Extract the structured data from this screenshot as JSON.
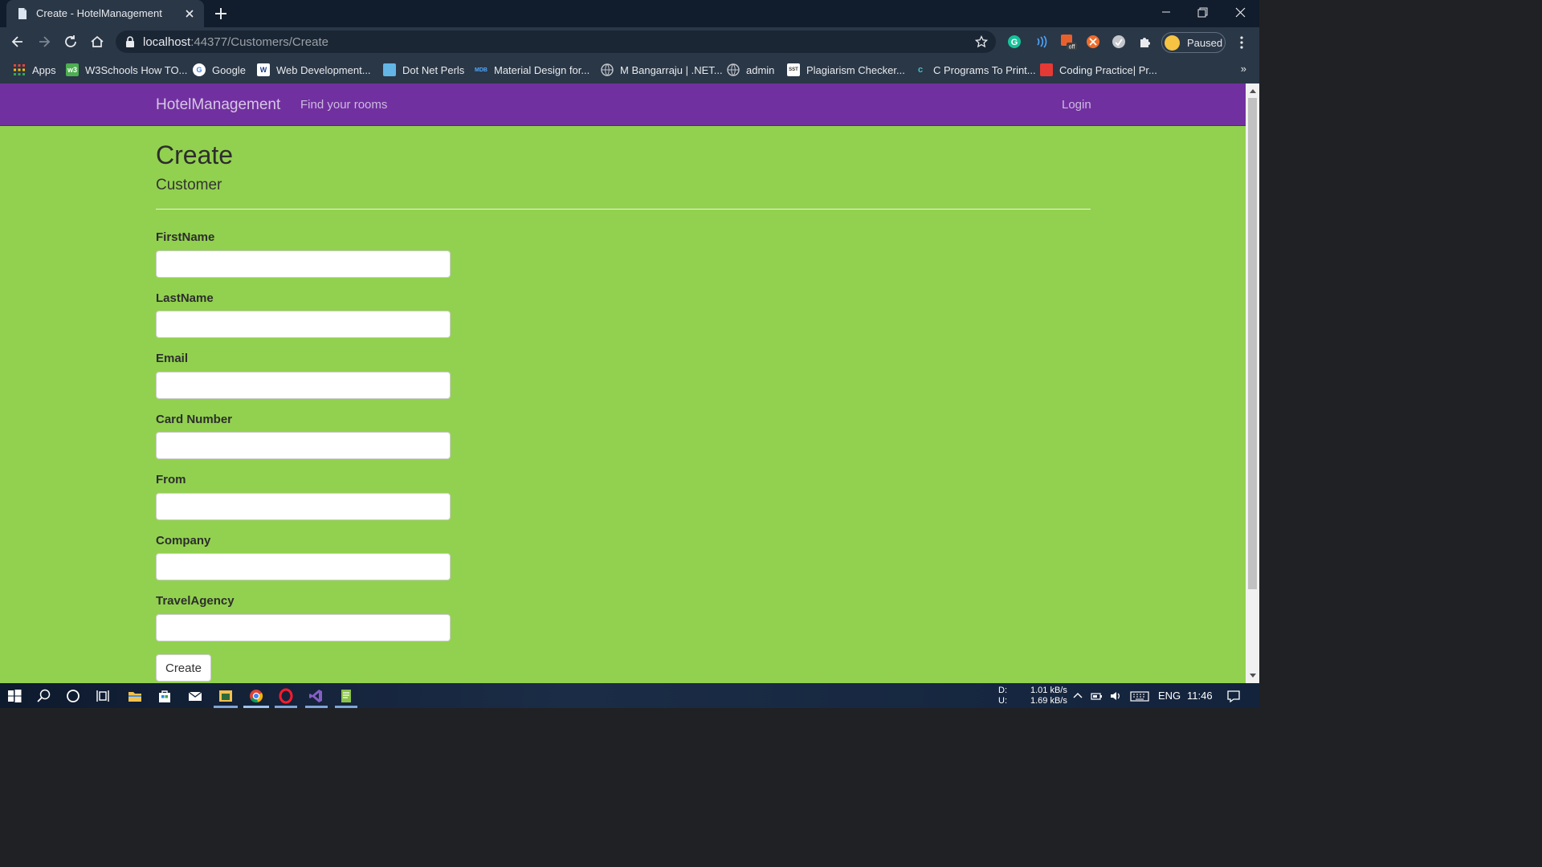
{
  "browser": {
    "tab_title": "Create - HotelManagement",
    "url_host": "localhost",
    "url_path": ":44377/Customers/Create",
    "profile_label": "Paused",
    "bookmarks": [
      {
        "label": "Apps",
        "icon": "apps-grid-icon",
        "color": "#e8453c"
      },
      {
        "label": "W3Schools How TO...",
        "icon": "w3schools-icon",
        "color": "#4caf50"
      },
      {
        "label": "Google",
        "icon": "google-icon",
        "color": "#ffffff"
      },
      {
        "label": "Web Development...",
        "icon": "web-dev-icon",
        "color": "#ffffff"
      },
      {
        "label": "Dot Net Perls",
        "icon": "dotnetperls-icon",
        "color": "#62b5e5"
      },
      {
        "label": "Material Design for...",
        "icon": "mdb-icon",
        "color": "#1976d2"
      },
      {
        "label": "M Bangarraju | .NET...",
        "icon": "globe-icon",
        "color": "#9aa0a6"
      },
      {
        "label": "admin",
        "icon": "globe-icon",
        "color": "#9aa0a6"
      },
      {
        "label": "Plagiarism Checker...",
        "icon": "sst-icon",
        "color": "#ffffff"
      },
      {
        "label": "C Programs To Print...",
        "icon": "c-programs-icon",
        "color": "#1b8a8a"
      },
      {
        "label": "Coding Practice| Pr...",
        "icon": "coding-practice-icon",
        "color": "#e53935"
      }
    ],
    "bookmarks_overflow": "»"
  },
  "site": {
    "brand": "HotelManagement",
    "nav_find_rooms": "Find your rooms",
    "nav_login": "Login",
    "navbar_color": "#7130a0",
    "page_bg_color": "#92d14f"
  },
  "page": {
    "title": "Create",
    "subtitle": "Customer",
    "fields": [
      {
        "label": "FirstName",
        "value": ""
      },
      {
        "label": "LastName",
        "value": ""
      },
      {
        "label": "Email",
        "value": ""
      },
      {
        "label": "Card Number",
        "value": ""
      },
      {
        "label": "From",
        "value": ""
      },
      {
        "label": "Company",
        "value": ""
      },
      {
        "label": "TravelAgency",
        "value": ""
      }
    ],
    "submit_label": "Create"
  },
  "taskbar": {
    "net_down_label": "D:",
    "net_up_label": "U:",
    "net_down": "1.01 kB/s",
    "net_up": "1.69 kB/s",
    "language": "ENG",
    "clock": "11:46"
  }
}
